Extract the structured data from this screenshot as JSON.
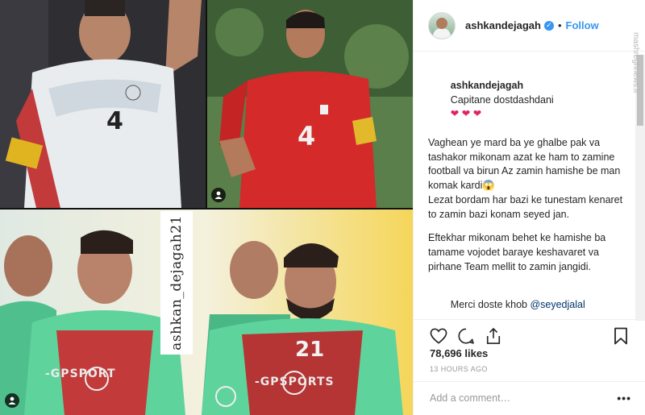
{
  "post": {
    "username": "ashkandejagah",
    "follow_label": "Follow",
    "separator": "•",
    "caption": {
      "line1": "Capitane dostdashdani",
      "hearts": "❤ ❤ ❤",
      "p1": "Vaghean ye mard ba ye ghalbe pak va tashakor mikonam azat ke ham to zamine football va birun Az zamin hamishe be man komak kardi😱",
      "p2": "Lezat bordam har bazi ke tunestam kenaret to zamin bazi konam seyed jan.",
      "p3": "Eftekhar mikonam behet ke hamishe ba tamame vojodet baraye keshavaret va pirhane Team mellit to zamin jangidi.",
      "p4_text": "Merci doste khob ",
      "p4_mention": "@seyedjalal"
    },
    "likes": "78,696 likes",
    "time": "13 HOURS AGO",
    "comment_placeholder": "Add a comment…",
    "more_label": "•••"
  },
  "media": {
    "watermark_handle": "ashkan_dejagah21",
    "bib_text_left": "-GPSPORT",
    "bib_text_right": "-GPSPORTS",
    "shirt_number_left": "4",
    "shirt_number_right": "4",
    "shirt_number_bottom": "21"
  },
  "site_watermark": "mashreghnews.ir",
  "colors": {
    "accent": "#3897f0",
    "heart": "#e0245e",
    "mention": "#003569"
  }
}
